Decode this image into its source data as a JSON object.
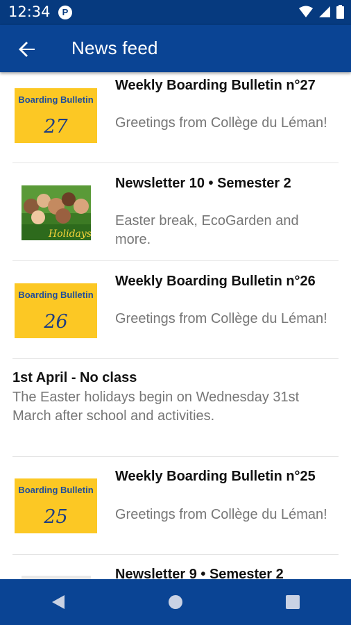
{
  "status": {
    "time": "12:34",
    "app_badge": "P"
  },
  "app_bar": {
    "title": "News feed"
  },
  "feed": [
    {
      "kind": "bulletin",
      "thumb_title": "Boarding Bulletin",
      "thumb_number": "27",
      "title": "Weekly Boarding Bulletin n°27",
      "desc": "Greetings from Collège du Léman!"
    },
    {
      "kind": "photo",
      "photo_caption": "Holidays",
      "title": "Newsletter 10 • Semester 2",
      "desc": "Easter break, EcoGarden and more."
    },
    {
      "kind": "bulletin",
      "thumb_title": "Boarding Bulletin",
      "thumb_number": "26",
      "title": "Weekly Boarding Bulletin n°26",
      "desc": "Greetings from Collège du Léman!"
    },
    {
      "kind": "notice",
      "title": "1st April - No class",
      "desc": "The Easter holidays begin on Wednesday 31st March after school and activities."
    },
    {
      "kind": "bulletin",
      "thumb_title": "Boarding Bulletin",
      "thumb_number": "25",
      "title": "Weekly Boarding Bulletin n°25",
      "desc": "Greetings from Collège du Léman!"
    },
    {
      "kind": "partial",
      "title": "Newsletter 9 • Semester 2"
    }
  ],
  "colors": {
    "status_bar": "#063a7f",
    "app_bar": "#0a4494",
    "bulletin_yellow": "#fcc824"
  }
}
